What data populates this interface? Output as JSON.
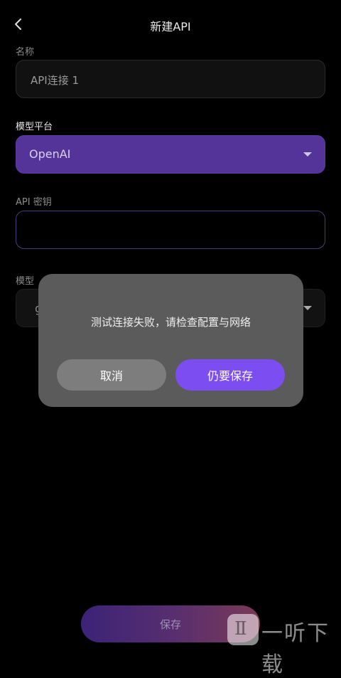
{
  "header": {
    "title": "新建API",
    "back_icon": "chevron-left-icon"
  },
  "form": {
    "name_label": "名称",
    "name_value": "API连接 1",
    "platform_label": "模型平台",
    "platform_value": "OpenAI",
    "key_label": "API 密钥",
    "key_value": "",
    "model_label": "模型",
    "model_value": "g"
  },
  "dialog": {
    "message": "测试连接失败，请检查配置与网络",
    "cancel_label": "取消",
    "confirm_label": "仍要保存"
  },
  "footer": {
    "save_label": "保存"
  },
  "watermark": {
    "text": "一听下载"
  },
  "colors": {
    "background": "#000000",
    "accent": "#7c4df0",
    "platform_field": "#55349a",
    "dialog": "#5b5b5b"
  }
}
